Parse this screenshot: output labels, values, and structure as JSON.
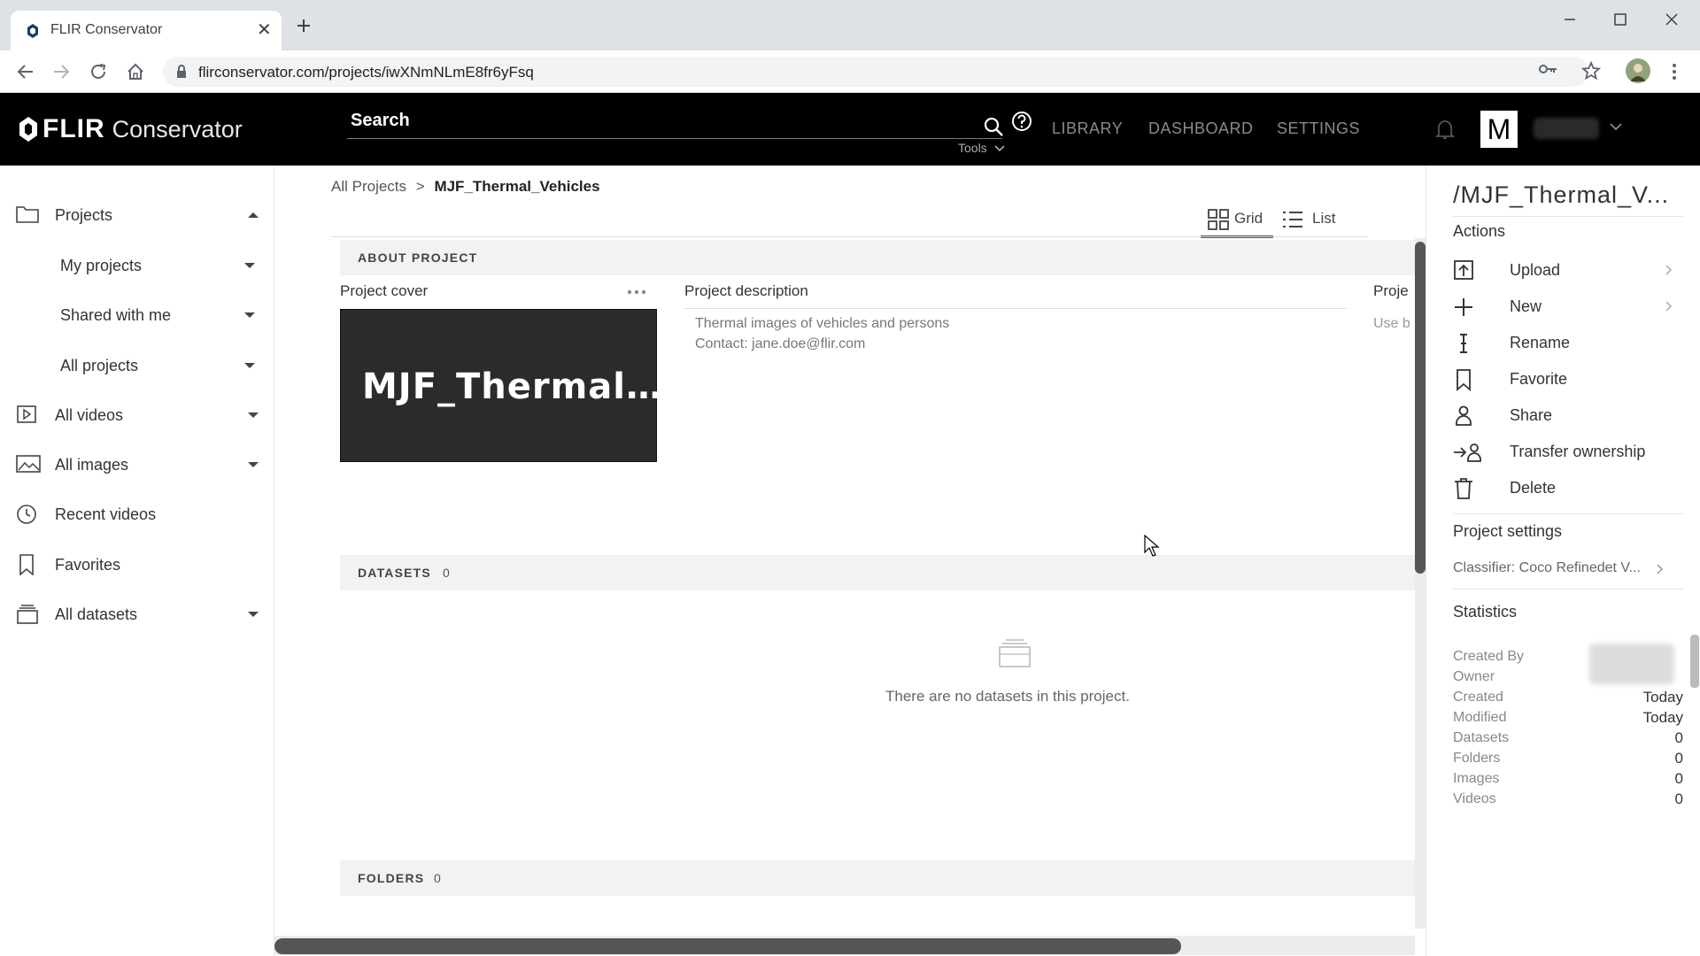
{
  "browser": {
    "tab_title": "FLIR Conservator",
    "new_tab": "+",
    "close": "✕",
    "url": "flirconservator.com/projects/iwXNmNLmE8fr6yFsq"
  },
  "header": {
    "logo_bold": "FLIR",
    "logo_light": "Conservator",
    "search_label": "Search",
    "tools_label": "Tools",
    "nav": [
      "LIBRARY",
      "DASHBOARD",
      "SETTINGS"
    ],
    "avatar_letter": "M"
  },
  "sidebar": {
    "items": [
      {
        "label": "Projects",
        "icon": "folder-icon"
      },
      {
        "label": "My projects"
      },
      {
        "label": "Shared with me"
      },
      {
        "label": "All projects"
      },
      {
        "label": "All videos",
        "icon": "video-icon"
      },
      {
        "label": "All images",
        "icon": "image-icon"
      },
      {
        "label": "Recent videos",
        "icon": "clock-icon"
      },
      {
        "label": "Favorites",
        "icon": "bookmark-icon"
      },
      {
        "label": "All datasets",
        "icon": "dataset-icon"
      }
    ]
  },
  "main": {
    "breadcrumb_root": "All Projects",
    "breadcrumb_sep": ">",
    "breadcrumb_current": "MJF_Thermal_Vehicles",
    "view_grid": "Grid",
    "view_list": "List",
    "about_title": "ABOUT PROJECT",
    "cover_label": "Project cover",
    "cover_text": "MJF_Thermal…",
    "description_label": "Project description",
    "description_line1": "Thermal images of vehicles and persons",
    "description_line2": "Contact: jane.doe@flir.com",
    "third_col_label": "Proje",
    "third_col_text": "Use b",
    "datasets_title": "DATASETS",
    "datasets_count": "0",
    "empty_datasets": "There are no datasets in this project.",
    "folders_title": "FOLDERS",
    "folders_count": "0"
  },
  "panel": {
    "title": "/MJF_Thermal_V...",
    "actions_heading": "Actions",
    "actions": [
      {
        "label": "Upload",
        "icon": "upload-icon"
      },
      {
        "label": "New",
        "icon": "plus-icon"
      },
      {
        "label": "Rename",
        "icon": "text-cursor-icon"
      },
      {
        "label": "Favorite",
        "icon": "bookmark-icon"
      },
      {
        "label": "Share",
        "icon": "share-user-icon"
      },
      {
        "label": "Transfer ownership",
        "icon": "transfer-user-icon"
      },
      {
        "label": "Delete",
        "icon": "trash-icon"
      }
    ],
    "settings_heading": "Project settings",
    "classifier": "Classifier: Coco Refinedet V...",
    "statistics_heading": "Statistics",
    "stats": [
      {
        "key": "Created By",
        "value": ""
      },
      {
        "key": "Owner",
        "value": ""
      },
      {
        "key": "Created",
        "value": "Today"
      },
      {
        "key": "Modified",
        "value": "Today"
      },
      {
        "key": "Datasets",
        "value": "0"
      },
      {
        "key": "Folders",
        "value": "0"
      },
      {
        "key": "Images",
        "value": "0"
      },
      {
        "key": "Videos",
        "value": "0"
      }
    ]
  },
  "colors": {
    "header_bg": "#000000",
    "cover_bg": "#2c2a2b",
    "section_bar": "#f2f2f2"
  }
}
